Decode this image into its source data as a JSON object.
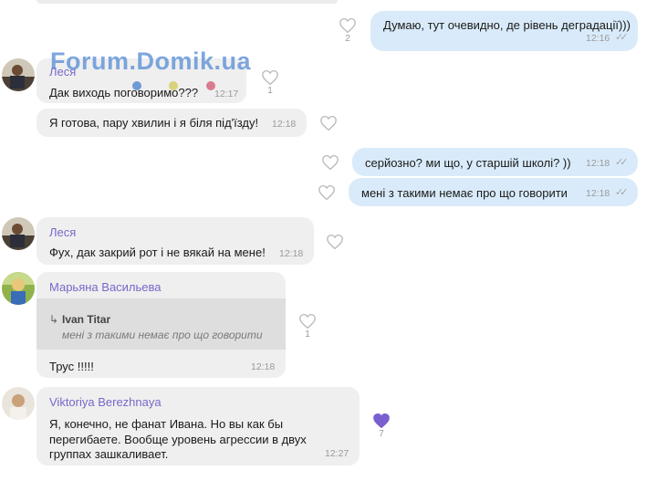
{
  "watermark": "Forum.Domik.ua",
  "messages": {
    "m1": {
      "text": "Думаю, тут очевидно, де рівень деградації)))",
      "time": "12:16",
      "likes": "2"
    },
    "m2": {
      "sender": "Леся",
      "text": "Дак виходь поговоримо???",
      "time": "12:17",
      "likes": "1"
    },
    "m3": {
      "text": "Я готова, пару хвилин і я біля під'їзду!",
      "time": "12:18"
    },
    "m4": {
      "text": "серйозно? ми що, у старшій школі? ))",
      "time": "12:18"
    },
    "m5": {
      "text": "мені з такими немає про що говорити",
      "time": "12:18"
    },
    "m6": {
      "sender": "Леся",
      "text": "Фух, дак закрий рот і не вякай на мене!",
      "time": "12:18"
    },
    "m7": {
      "sender": "Марьяна Васильева",
      "quote_name": "Ivan Titar",
      "quote_text": "мені з такими немає про що говорити",
      "text": "Трус !!!!!",
      "time": "12:18",
      "likes": "1"
    },
    "m8": {
      "sender": "Viktoriya Berezhnaya",
      "line1": "Я, конечно, не фанат Ивана. Но вы как бы",
      "line2": "перегибаете. Вообще уровень агрессии в двух",
      "line3": "группах зашкаливает.",
      "time": "12:27",
      "likes": "7"
    }
  },
  "colors": {
    "accent": "#7a67c9",
    "liked_heart": "#7a5fd0",
    "outgoing_bubble": "#d9ebfa",
    "incoming_bubble": "#efefef"
  }
}
